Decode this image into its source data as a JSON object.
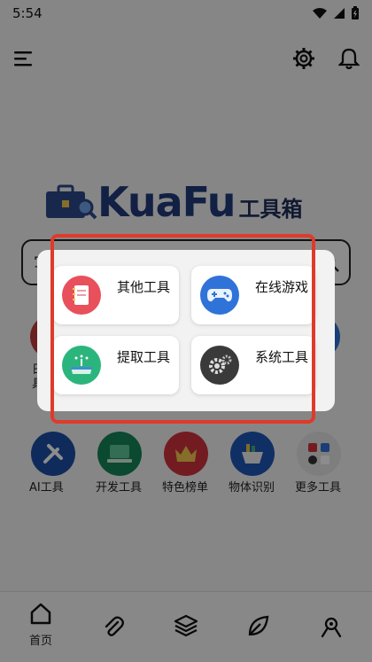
{
  "status_bar": {
    "time": "5:54"
  },
  "logo": {
    "brand": "KuaFu",
    "suffix": "工具箱"
  },
  "search": {
    "placeholder": "写"
  },
  "behind_rows": {
    "left_label": "日",
    "left_label2": "具"
  },
  "tools": [
    {
      "label": "AI工具",
      "color": "#1d4fa8",
      "icon": "wrench-icon"
    },
    {
      "label": "开发工具",
      "color": "#17865a",
      "icon": "laptop-icon"
    },
    {
      "label": "特色榜单",
      "color": "#d0343e",
      "icon": "crown-icon"
    },
    {
      "label": "物体识别",
      "color": "#1e58b8",
      "icon": "basket-icon"
    },
    {
      "label": "更多工具",
      "color": "#e6e6e6",
      "icon": "grid-icon"
    }
  ],
  "popup": {
    "cards": [
      {
        "label": "其他工具",
        "color": "#e8505b",
        "icon": "notebook-icon"
      },
      {
        "label": "在线游戏",
        "color": "#2f73d8",
        "icon": "gamepad-icon"
      },
      {
        "label": "提取工具",
        "color": "#2bb57c",
        "icon": "extract-icon"
      },
      {
        "label": "系统工具",
        "color": "#3a3a3a",
        "icon": "gear-icon"
      }
    ]
  },
  "bottom_nav": {
    "home_label": "首页"
  }
}
